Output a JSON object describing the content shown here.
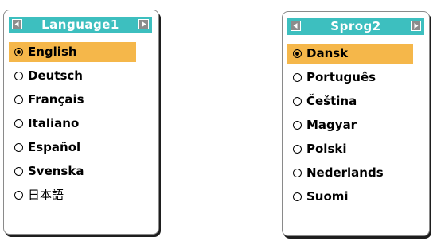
{
  "panel1": {
    "title": "Language1",
    "selected_index": 0,
    "options": [
      {
        "label": "English"
      },
      {
        "label": "Deutsch"
      },
      {
        "label": "Français"
      },
      {
        "label": "Italiano"
      },
      {
        "label": "Español"
      },
      {
        "label": "Svenska"
      },
      {
        "label": "日本語"
      }
    ]
  },
  "panel2": {
    "title": "Sprog2",
    "selected_index": 0,
    "options": [
      {
        "label": "Dansk"
      },
      {
        "label": "Português"
      },
      {
        "label": "Čeština"
      },
      {
        "label": "Magyar"
      },
      {
        "label": "Polski"
      },
      {
        "label": "Nederlands"
      },
      {
        "label": "Suomi"
      }
    ]
  },
  "colors": {
    "header": "#3dbfbf",
    "selected_highlight": "#f5b74a",
    "arrow_button": "#8c8c8c"
  },
  "icons": {
    "left": "left-arrow-icon",
    "right": "right-arrow-icon",
    "radio": "radio-button-icon"
  }
}
